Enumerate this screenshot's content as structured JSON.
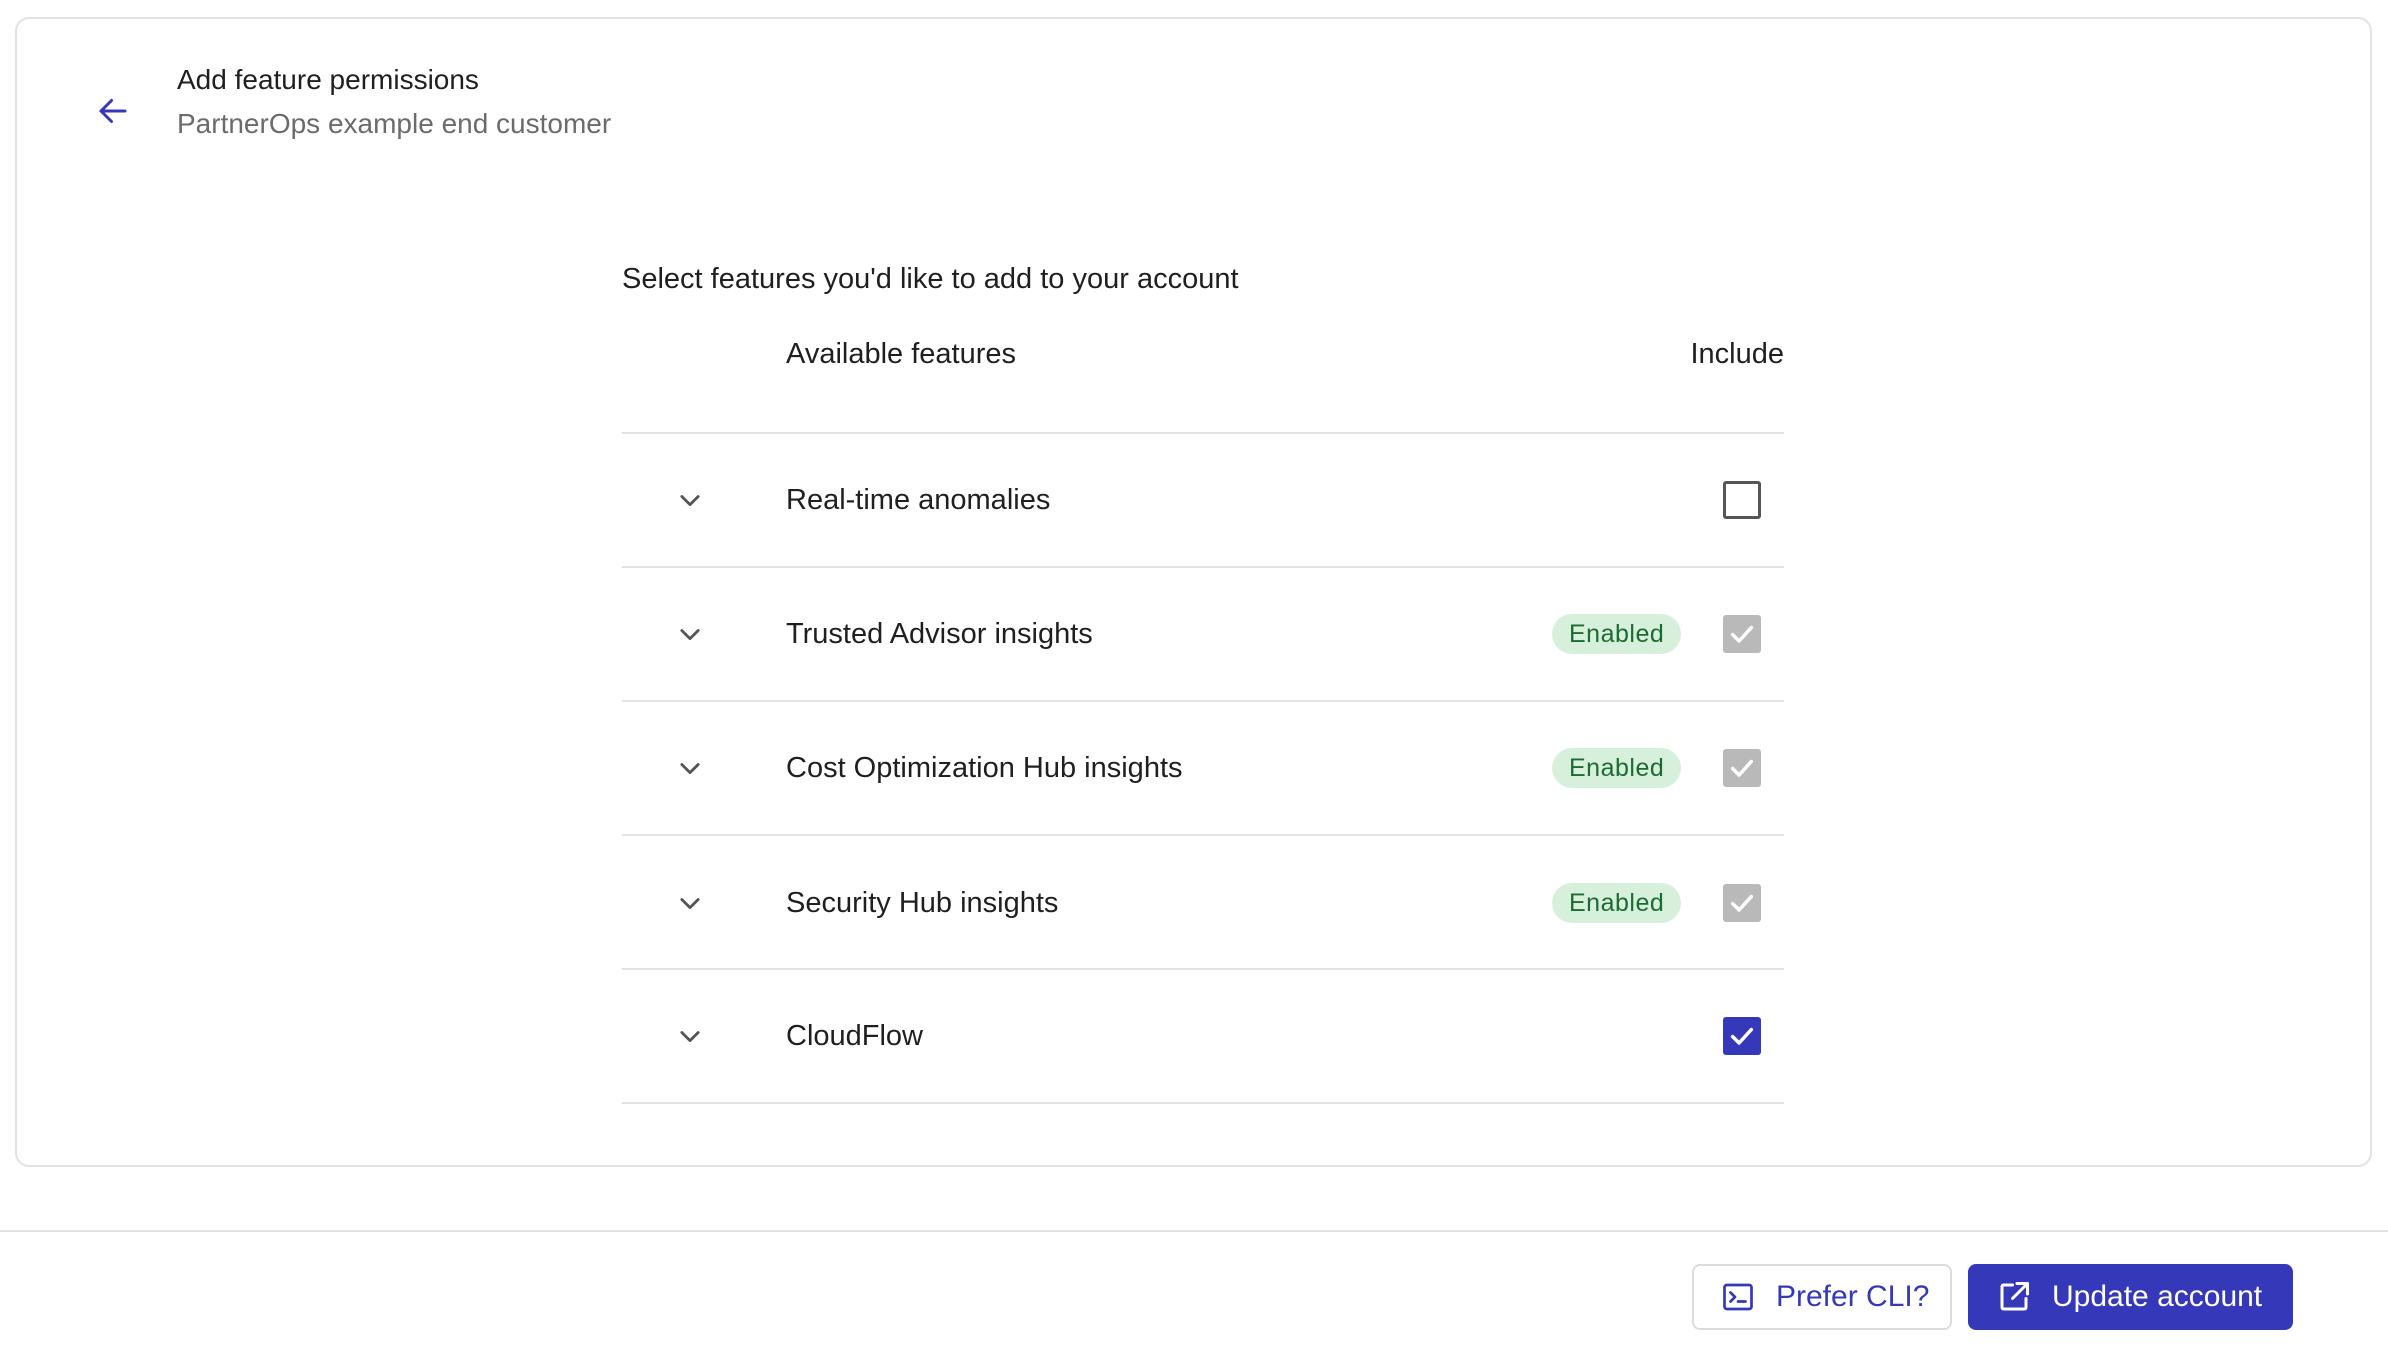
{
  "header": {
    "title": "Add feature permissions",
    "subtitle": "PartnerOps example end customer",
    "back_icon": "arrow-left-icon"
  },
  "section": {
    "title": "Select features you'd like to add to your account",
    "columns": {
      "features": "Available features",
      "include": "Include"
    }
  },
  "features": [
    {
      "label": "Real-time anomalies",
      "badge": "",
      "state": "unchecked"
    },
    {
      "label": "Trusted Advisor insights",
      "badge": "Enabled",
      "state": "checked-disabled"
    },
    {
      "label": "Cost Optimization Hub insights",
      "badge": "Enabled",
      "state": "checked-disabled"
    },
    {
      "label": "Security Hub insights",
      "badge": "Enabled",
      "state": "checked-disabled"
    },
    {
      "label": "CloudFlow",
      "badge": "",
      "state": "checked"
    }
  ],
  "footer": {
    "cli_label": "Prefer CLI?",
    "cli_icon": "terminal-icon",
    "update_label": "Update account",
    "update_icon": "external-link-icon"
  },
  "colors": {
    "accent": "#3538b8",
    "badge_bg": "#d7f0dc",
    "badge_text": "#1c6b32",
    "disabled_checkbox": "#b9b9b9"
  }
}
